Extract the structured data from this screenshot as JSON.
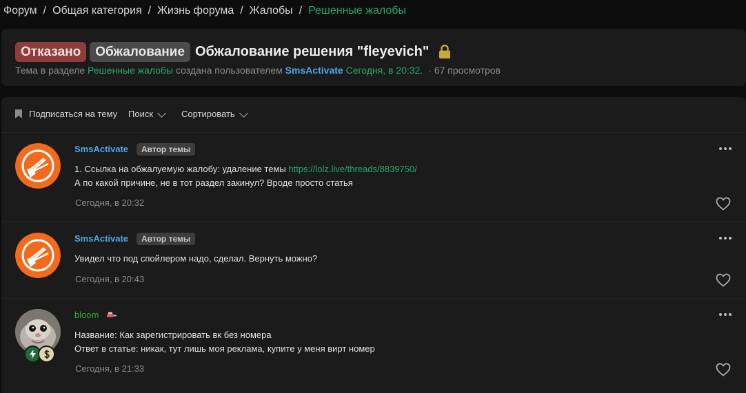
{
  "breadcrumbs": [
    "Форум",
    "Общая категория",
    "Жизнь форума",
    "Жалобы",
    "Решенные жалобы"
  ],
  "breadcrumb_separator": "/",
  "thread": {
    "tag_rejected": "Отказано",
    "tag_appeal": "Обжалование",
    "title": "Обжалование решения \"fleyevich\"",
    "meta_prefix": "Тема в разделе",
    "meta_section": "Решенные жалобы",
    "meta_created_by": "создана пользователем",
    "meta_author": "SmsActivate",
    "meta_time": "Сегодня, в 20:32.",
    "meta_views": "67 просмотров"
  },
  "toolbar": {
    "subscribe": "Подписаться на тему",
    "search": "Поиск",
    "sort": "Сортировать"
  },
  "posts": [
    {
      "username": "SmsActivate",
      "badge": "Автор темы",
      "line1_text": "1. Ссылка на обжалуемую жалобу: удаление темы",
      "line1_link": "https://lolz.live/threads/8839750/",
      "line2": "А по какой причине, не в тот раздел закинул? Вроде просто статья",
      "date": "Сегодня, в 20:32"
    },
    {
      "username": "SmsActivate",
      "badge": "Автор темы",
      "line1": "Увидел что под спойлером надо, сделал. Вернуть можно?",
      "date": "Сегодня, в 20:43"
    },
    {
      "username": "bloom",
      "line1": "Название: Как зарегистрировать вк без номера",
      "line2": "Ответ в статье: никак, тут лишь моя реклама, купите у меня вирт номер",
      "date": "Сегодня, в 21:33"
    }
  ],
  "colors": {
    "accent_green": "#27a76d",
    "username_blue": "#4aa7e6",
    "rejected_red": "#8f3c3c",
    "lock_gold": "#c9a83a",
    "avatar_orange": "#f36a1c"
  },
  "icons": [
    "lock-icon",
    "bookmark-icon",
    "chevron-down-icon",
    "more-icon",
    "heart-icon",
    "bolt-icon",
    "dollar-icon"
  ]
}
